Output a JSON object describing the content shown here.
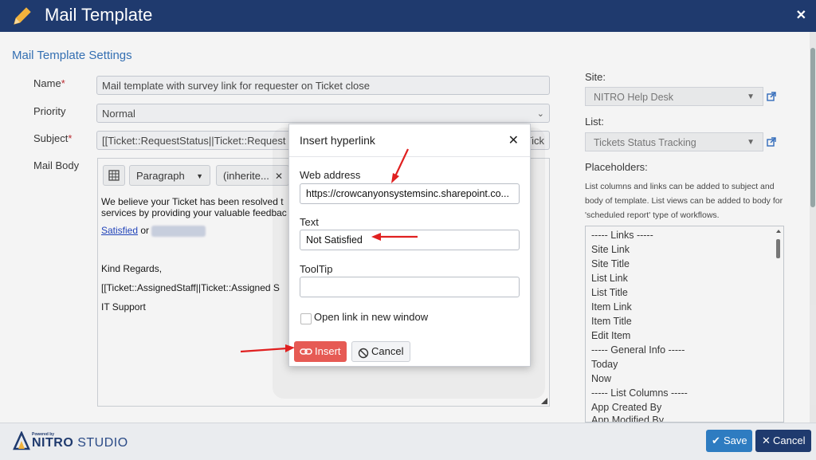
{
  "window": {
    "title": "Mail Template",
    "close_glyph": "✕"
  },
  "section_title": "Mail Template Settings",
  "form": {
    "name_label": "Name",
    "name_value": "Mail template with survey link for requester on Ticket close",
    "priority_label": "Priority",
    "priority_value": "Normal",
    "subject_label": "Subject",
    "subject_value": "[[Ticket::RequestStatus||Ticket::Request Sta",
    "subject_tail": "Tick",
    "mailbody_label": "Mail Body",
    "required_mark": "*"
  },
  "editor": {
    "toolbar": {
      "paragraph": "Paragraph",
      "inherit": "(inherite...",
      "clear": "✕"
    },
    "lines": {
      "line1": "We believe your Ticket has been resolved t",
      "line2": "services by providing your valuable feedbac",
      "satisfied_link": "Satisfied",
      "or_text": "or",
      "regards": "Kind Regards,",
      "assigned": "[[Ticket::AssignedStaff||Ticket::Assigned S",
      "signoff": "IT Support"
    }
  },
  "dialog": {
    "title": "Insert hyperlink",
    "close_glyph": "✕",
    "web_address_label": "Web address",
    "web_address_value": "https://crowcanyonsystemsinc.sharepoint.co...",
    "text_label": "Text",
    "text_value": "Not Satisfied",
    "tooltip_label": "ToolTip",
    "tooltip_value": "",
    "new_window_label": "Open link in new window",
    "new_window_checked": false,
    "insert_label": "Insert",
    "cancel_label": "Cancel"
  },
  "right_panel": {
    "site_label": "Site:",
    "site_value": "NITRO Help Desk",
    "list_label": "List:",
    "list_value": "Tickets Status Tracking",
    "placeholders_label": "Placeholders:",
    "help_text": "List columns and links can be added to subject and body of template. List views can be added to body for 'scheduled report' type of workflows.",
    "placeholders": [
      "----- Links -----",
      "Site Link",
      "Site Title",
      "List Link",
      "List Title",
      "Item Link",
      "Item Title",
      "Edit Item",
      "----- General Info -----",
      "Today",
      "Now",
      "----- List Columns -----",
      "App Created By",
      "App Modified By"
    ]
  },
  "footer": {
    "brand_powered": "Powered by",
    "brand_name": "NITRO",
    "brand_suffix": "STUDIO",
    "save_label": "Save",
    "cancel_label": "Cancel"
  },
  "colors": {
    "titlebar": "#1f3a6e",
    "section_title": "#2f6fb8",
    "insert_button": "#e65a54",
    "annotation_arrow": "#e02020",
    "save_button": "#2e7cc1"
  }
}
